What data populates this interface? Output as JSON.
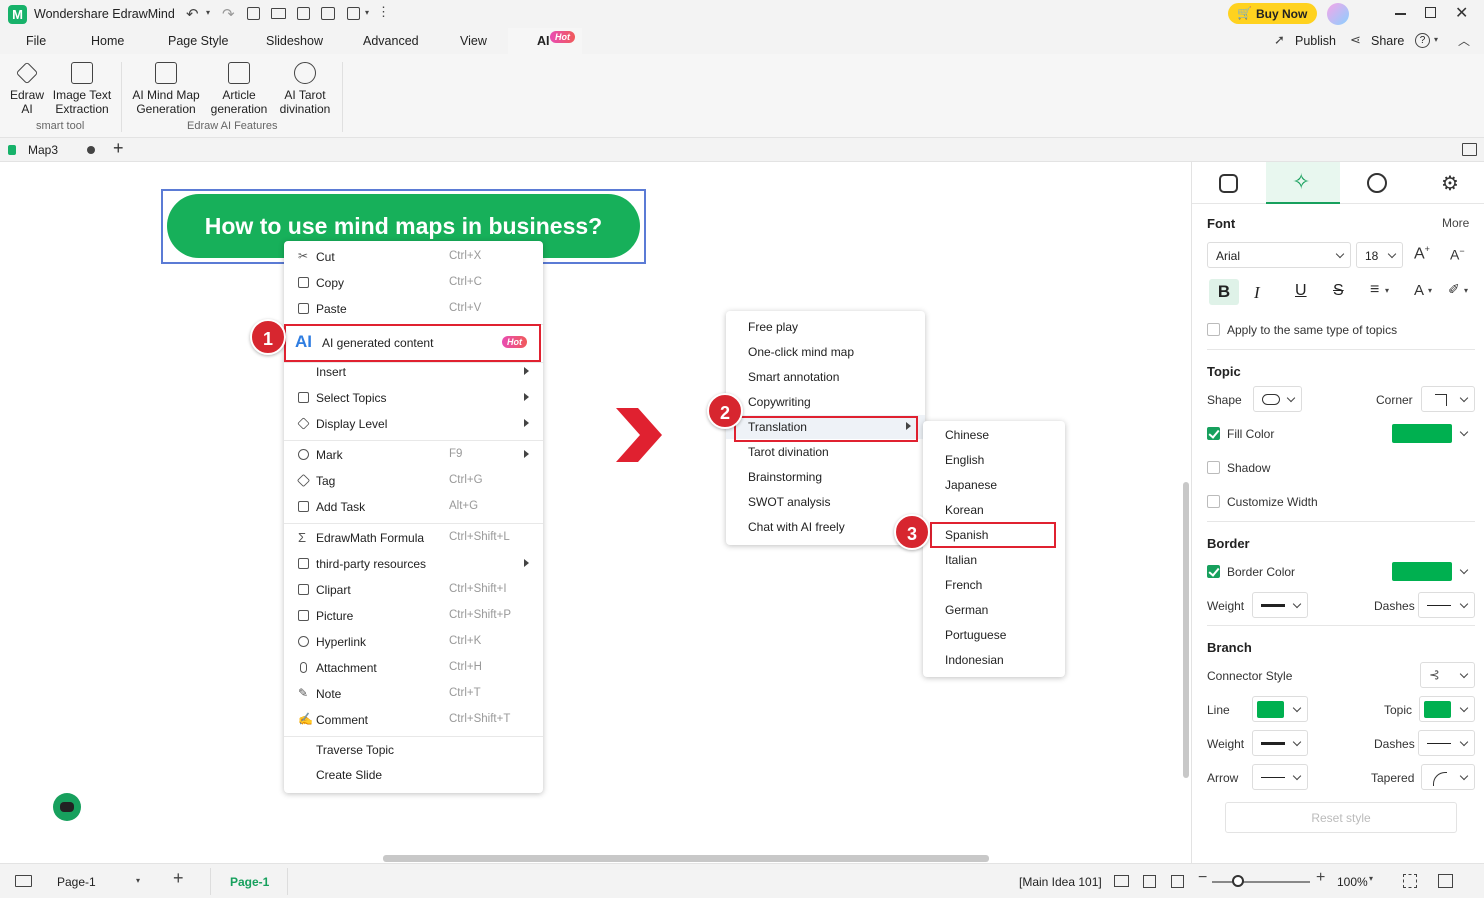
{
  "app": {
    "title": "Wondershare EdrawMind",
    "buy_now": "Buy Now",
    "publish": "Publish",
    "share": "Share",
    "help": "?"
  },
  "menu": {
    "tabs": [
      "File",
      "Home",
      "Page Style",
      "Slideshow",
      "Advanced",
      "View",
      "AI"
    ],
    "ai_badge": "Hot"
  },
  "ribbon": {
    "smart": [
      {
        "line1": "Edraw",
        "line2": "AI"
      },
      {
        "line1": "Image Text",
        "line2": "Extraction"
      }
    ],
    "smart_group": "smart tool",
    "features": [
      {
        "line1": "AI Mind Map",
        "line2": "Generation"
      },
      {
        "line1": "Article",
        "line2": "generation"
      },
      {
        "line1": "AI Tarot",
        "line2": "divination"
      }
    ],
    "features_group": "Edraw AI Features"
  },
  "doc_tab": {
    "name": "Map3"
  },
  "canvas": {
    "topic": "How to use mind maps in business?",
    "arrow_color": "#e02130"
  },
  "context_menu": {
    "items": [
      {
        "label": "Cut",
        "shortcut": "Ctrl+X"
      },
      {
        "label": "Copy",
        "shortcut": "Ctrl+C"
      },
      {
        "label": "Paste",
        "shortcut": "Ctrl+V"
      },
      {
        "label": "AI generated content",
        "shortcut": "Hot"
      },
      {
        "label": "Insert",
        "shortcut": ""
      },
      {
        "label": "Select Topics",
        "shortcut": ""
      },
      {
        "label": "Display Level",
        "shortcut": ""
      },
      {
        "label": "Mark",
        "shortcut": "F9"
      },
      {
        "label": "Tag",
        "shortcut": "Ctrl+G"
      },
      {
        "label": "Add Task",
        "shortcut": "Alt+G"
      },
      {
        "label": "EdrawMath Formula",
        "shortcut": "Ctrl+Shift+L"
      },
      {
        "label": "third-party resources",
        "shortcut": ""
      },
      {
        "label": "Clipart",
        "shortcut": "Ctrl+Shift+I"
      },
      {
        "label": "Picture",
        "shortcut": "Ctrl+Shift+P"
      },
      {
        "label": "Hyperlink",
        "shortcut": "Ctrl+K"
      },
      {
        "label": "Attachment",
        "shortcut": "Ctrl+H"
      },
      {
        "label": "Note",
        "shortcut": "Ctrl+T"
      },
      {
        "label": "Comment",
        "shortcut": "Ctrl+Shift+T"
      },
      {
        "label": "Traverse Topic",
        "shortcut": ""
      },
      {
        "label": "Create Slide",
        "shortcut": ""
      }
    ]
  },
  "ai_menu": {
    "items": [
      "Free play",
      "One-click mind map",
      "Smart annotation",
      "Copywriting",
      "Translation",
      "Tarot divination",
      "Brainstorming",
      "SWOT analysis",
      "Chat with AI freely"
    ]
  },
  "lang_menu": {
    "items": [
      "Chinese",
      "English",
      "Japanese",
      "Korean",
      "Spanish",
      "Italian",
      "French",
      "German",
      "Portuguese",
      "Indonesian"
    ]
  },
  "steps": [
    "1",
    "2",
    "3"
  ],
  "panel": {
    "font_header": "Font",
    "more": "More",
    "font_family": "Arial",
    "font_size": "18",
    "apply_same": "Apply to the same type of topics",
    "topic_header": "Topic",
    "shape": "Shape",
    "corner": "Corner",
    "fill_color": "Fill Color",
    "shadow": "Shadow",
    "customize_width": "Customize Width",
    "border_header": "Border",
    "border_color": "Border Color",
    "weight": "Weight",
    "dashes": "Dashes",
    "branch_header": "Branch",
    "connector_style": "Connector Style",
    "line": "Line",
    "topic": "Topic",
    "weight2": "Weight",
    "dashes2": "Dashes",
    "arrow": "Arrow",
    "tapered": "Tapered",
    "reset": "Reset style",
    "accent": "#00b050"
  },
  "status": {
    "page_select": "Page-1",
    "page_tab": "Page-1",
    "main_idea": "[Main Idea 101]",
    "zoom": "100%"
  }
}
